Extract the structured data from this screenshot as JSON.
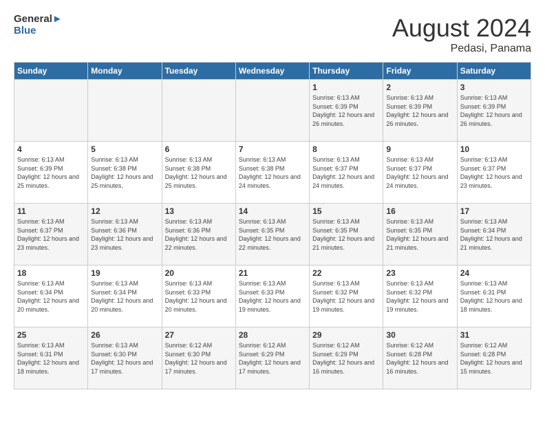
{
  "header": {
    "logo_general": "General",
    "logo_blue": "Blue",
    "month_year": "August 2024",
    "location": "Pedasi, Panama"
  },
  "weekdays": [
    "Sunday",
    "Monday",
    "Tuesday",
    "Wednesday",
    "Thursday",
    "Friday",
    "Saturday"
  ],
  "weeks": [
    [
      {
        "day": "",
        "content": ""
      },
      {
        "day": "",
        "content": ""
      },
      {
        "day": "",
        "content": ""
      },
      {
        "day": "",
        "content": ""
      },
      {
        "day": "1",
        "content": "Sunrise: 6:13 AM\nSunset: 6:39 PM\nDaylight: 12 hours and 26 minutes."
      },
      {
        "day": "2",
        "content": "Sunrise: 6:13 AM\nSunset: 6:39 PM\nDaylight: 12 hours and 26 minutes."
      },
      {
        "day": "3",
        "content": "Sunrise: 6:13 AM\nSunset: 6:39 PM\nDaylight: 12 hours and 26 minutes."
      }
    ],
    [
      {
        "day": "4",
        "content": "Sunrise: 6:13 AM\nSunset: 6:39 PM\nDaylight: 12 hours and 25 minutes."
      },
      {
        "day": "5",
        "content": "Sunrise: 6:13 AM\nSunset: 6:38 PM\nDaylight: 12 hours and 25 minutes."
      },
      {
        "day": "6",
        "content": "Sunrise: 6:13 AM\nSunset: 6:38 PM\nDaylight: 12 hours and 25 minutes."
      },
      {
        "day": "7",
        "content": "Sunrise: 6:13 AM\nSunset: 6:38 PM\nDaylight: 12 hours and 24 minutes."
      },
      {
        "day": "8",
        "content": "Sunrise: 6:13 AM\nSunset: 6:37 PM\nDaylight: 12 hours and 24 minutes."
      },
      {
        "day": "9",
        "content": "Sunrise: 6:13 AM\nSunset: 6:37 PM\nDaylight: 12 hours and 24 minutes."
      },
      {
        "day": "10",
        "content": "Sunrise: 6:13 AM\nSunset: 6:37 PM\nDaylight: 12 hours and 23 minutes."
      }
    ],
    [
      {
        "day": "11",
        "content": "Sunrise: 6:13 AM\nSunset: 6:37 PM\nDaylight: 12 hours and 23 minutes."
      },
      {
        "day": "12",
        "content": "Sunrise: 6:13 AM\nSunset: 6:36 PM\nDaylight: 12 hours and 23 minutes."
      },
      {
        "day": "13",
        "content": "Sunrise: 6:13 AM\nSunset: 6:36 PM\nDaylight: 12 hours and 22 minutes."
      },
      {
        "day": "14",
        "content": "Sunrise: 6:13 AM\nSunset: 6:35 PM\nDaylight: 12 hours and 22 minutes."
      },
      {
        "day": "15",
        "content": "Sunrise: 6:13 AM\nSunset: 6:35 PM\nDaylight: 12 hours and 21 minutes."
      },
      {
        "day": "16",
        "content": "Sunrise: 6:13 AM\nSunset: 6:35 PM\nDaylight: 12 hours and 21 minutes."
      },
      {
        "day": "17",
        "content": "Sunrise: 6:13 AM\nSunset: 6:34 PM\nDaylight: 12 hours and 21 minutes."
      }
    ],
    [
      {
        "day": "18",
        "content": "Sunrise: 6:13 AM\nSunset: 6:34 PM\nDaylight: 12 hours and 20 minutes."
      },
      {
        "day": "19",
        "content": "Sunrise: 6:13 AM\nSunset: 6:34 PM\nDaylight: 12 hours and 20 minutes."
      },
      {
        "day": "20",
        "content": "Sunrise: 6:13 AM\nSunset: 6:33 PM\nDaylight: 12 hours and 20 minutes."
      },
      {
        "day": "21",
        "content": "Sunrise: 6:13 AM\nSunset: 6:33 PM\nDaylight: 12 hours and 19 minutes."
      },
      {
        "day": "22",
        "content": "Sunrise: 6:13 AM\nSunset: 6:32 PM\nDaylight: 12 hours and 19 minutes."
      },
      {
        "day": "23",
        "content": "Sunrise: 6:13 AM\nSunset: 6:32 PM\nDaylight: 12 hours and 19 minutes."
      },
      {
        "day": "24",
        "content": "Sunrise: 6:13 AM\nSunset: 6:31 PM\nDaylight: 12 hours and 18 minutes."
      }
    ],
    [
      {
        "day": "25",
        "content": "Sunrise: 6:13 AM\nSunset: 6:31 PM\nDaylight: 12 hours and 18 minutes."
      },
      {
        "day": "26",
        "content": "Sunrise: 6:13 AM\nSunset: 6:30 PM\nDaylight: 12 hours and 17 minutes."
      },
      {
        "day": "27",
        "content": "Sunrise: 6:12 AM\nSunset: 6:30 PM\nDaylight: 12 hours and 17 minutes."
      },
      {
        "day": "28",
        "content": "Sunrise: 6:12 AM\nSunset: 6:29 PM\nDaylight: 12 hours and 17 minutes."
      },
      {
        "day": "29",
        "content": "Sunrise: 6:12 AM\nSunset: 6:29 PM\nDaylight: 12 hours and 16 minutes."
      },
      {
        "day": "30",
        "content": "Sunrise: 6:12 AM\nSunset: 6:28 PM\nDaylight: 12 hours and 16 minutes."
      },
      {
        "day": "31",
        "content": "Sunrise: 6:12 AM\nSunset: 6:28 PM\nDaylight: 12 hours and 15 minutes."
      }
    ]
  ]
}
